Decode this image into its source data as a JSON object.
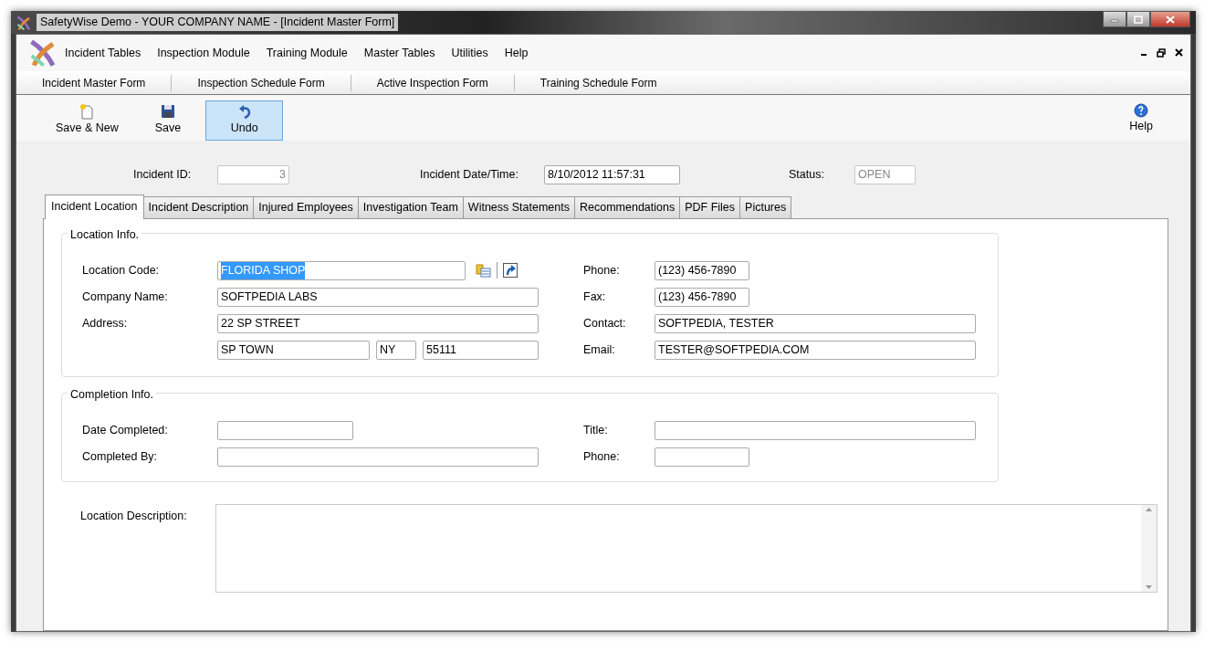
{
  "window": {
    "title": "SafetyWise Demo - YOUR COMPANY NAME - [Incident Master Form]"
  },
  "menu": [
    "Incident Tables",
    "Inspection Module",
    "Training Module",
    "Master Tables",
    "Utilities",
    "Help"
  ],
  "form_tabs": [
    "Incident Master Form",
    "Inspection Schedule Form",
    "Active Inspection Form",
    "Training Schedule Form"
  ],
  "toolbar": [
    {
      "label": "Save & New",
      "kind": "new",
      "hovered": false
    },
    {
      "label": "Save",
      "kind": "save",
      "hovered": false
    },
    {
      "label": "Undo",
      "kind": "undo",
      "hovered": true
    }
  ],
  "help_button": {
    "label": "Help"
  },
  "header_fields": [
    {
      "label": "Incident ID:",
      "value": "3",
      "disabled": true,
      "kind": "number"
    },
    {
      "label": "Incident Date/Time:",
      "value": "8/10/2012 11:57:31",
      "disabled": false,
      "kind": "text"
    },
    {
      "label": "Status:",
      "value": "OPEN",
      "disabled": true,
      "kind": "text"
    }
  ],
  "tabs": [
    {
      "label": "Incident Location",
      "selected": true
    },
    {
      "label": "Incident Description",
      "selected": false
    },
    {
      "label": "Injured Employees",
      "selected": false
    },
    {
      "label": "Investigation Team",
      "selected": false
    },
    {
      "label": "Witness Statements",
      "selected": false
    },
    {
      "label": "Recommendations",
      "selected": false
    },
    {
      "label": "PDF Files",
      "selected": false
    },
    {
      "label": "Pictures",
      "selected": false
    }
  ],
  "location_info": {
    "title": "Location Info.",
    "location_code": {
      "label": "Location Code:",
      "value": "FLORIDA SHOP",
      "text_selected": true
    },
    "company_name": {
      "label": "Company Name:",
      "value": "SOFTPEDIA LABS"
    },
    "address": {
      "label": "Address:",
      "street": "22 SP STREET",
      "city": "SP TOWN",
      "state": "NY",
      "zip": "55111"
    },
    "phone": {
      "label": "Phone:",
      "value": "(123) 456-7890"
    },
    "fax": {
      "label": "Fax:",
      "value": "(123) 456-7890"
    },
    "contact": {
      "label": "Contact:",
      "value": "SOFTPEDIA, TESTER"
    },
    "email": {
      "label": "Email:",
      "value": "TESTER@SOFTPEDIA.COM"
    }
  },
  "completion_info": {
    "title": "Completion Info.",
    "date_completed": {
      "label": "Date Completed:"
    },
    "completed_by": {
      "label": "Completed By:"
    },
    "title_field": {
      "label": "Title:"
    },
    "phone": {
      "label": "Phone:"
    }
  },
  "location_description": {
    "label": "Location Description:"
  }
}
